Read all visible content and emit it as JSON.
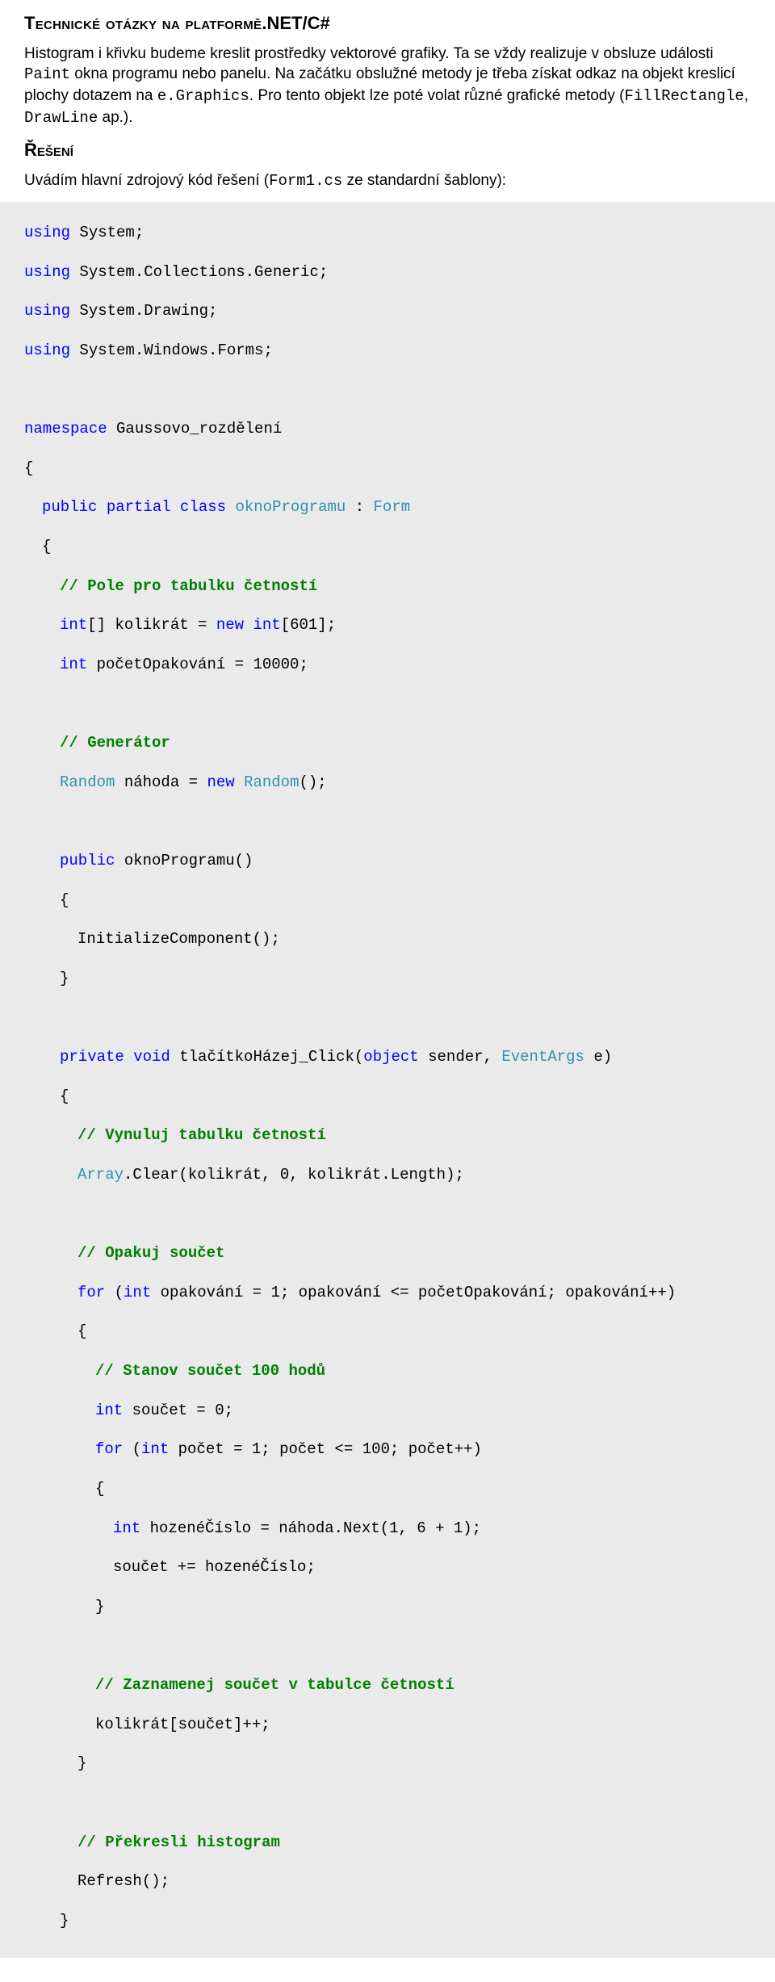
{
  "h1_a": "Technické otázky na platformě",
  "h1_b": ".NET/C#",
  "p1a": "Histogram i křivku budeme kreslit prostředky vektorové grafiky. Ta se vždy realizuje v obsluze události ",
  "p1c1": "Paint",
  "p1b": " okna programu nebo panelu. Na začátku obslužné metody je třeba získat odkaz na objekt kreslicí plochy dotazem na ",
  "p1c2": "e.Graphics",
  "p1c": ". Pro tento objekt lze poté volat různé grafické metody (",
  "p1c3": "FillRectangle",
  "p1d": ", ",
  "p1c4": "DrawLine",
  "p1e": " ap.).",
  "subhead": "Řešení",
  "p2a": "Uvádím hlavní zdrojový kód řešení (",
  "p2c1": "Form1.cs",
  "p2b": " ze standardní šablony):",
  "kw_using": "using",
  "ns_system": " System;",
  "ns_collections": " System.Collections.Generic;",
  "ns_drawing": " System.Drawing;",
  "ns_forms": " System.Windows.Forms;",
  "kw_namespace": "namespace",
  "ns_gauss": " Gaussovo_rozdělení",
  "br_o": "{",
  "br_c": "}",
  "kw_public": "public",
  "kw_partial": " partial ",
  "kw_class": "class",
  "cls_okno": " oknoProgramu",
  "colon_form": " : ",
  "type_form": "Form",
  "c_poleTab": "// Pole pro tabulku četností",
  "kw_int": "int",
  "arr_kolik": "[] kolikrát = ",
  "kw_new": "new",
  "arr_601": " int",
  "arr_601b": "[601];",
  "pocetOp": " početOpakování = 10000;",
  "c_gen": "// Generátor",
  "type_random": "Random",
  "rand_line_b": " náhoda = ",
  "rand_ctor": "Random",
  "rand_tail": "();",
  "ctor_head": " oknoProgramu()",
  "init_call": "InitializeComponent();",
  "kw_private": "private",
  "kw_void": " void",
  "click_name": " tlačítkoHázej_Click(",
  "kw_object": "object",
  "click_mid": " sender, ",
  "type_eventargs": "EventArgs",
  "click_tail": " e)",
  "c_vynul": "// Vynuluj tabulku četností",
  "array_clear": "Array",
  "array_clear_b": ".Clear(kolikrát, 0, kolikrát.Length);",
  "c_opakuj": "// Opakuj součet",
  "kw_for": "for",
  "for1_a": " (",
  "for1_b": " opakování = 1; opakování <= početOpakování; opakování++)",
  "c_stanov": "// Stanov součet 100 hodů",
  "soucet_decl": " součet = 0;",
  "for2_b": " počet = 1; počet <= 100; počet++)",
  "hozene_a": " hozenéČíslo = náhoda.Next(1, 6 + 1);",
  "soucet_add": "součet += hozenéČíslo;",
  "c_zaznam": "// Zaznamenej součet v tabulce četností",
  "kolikrat_inc": "kolikrát[součet]++;",
  "c_prekr": "// Překresli histogram",
  "refresh": "Refresh();"
}
